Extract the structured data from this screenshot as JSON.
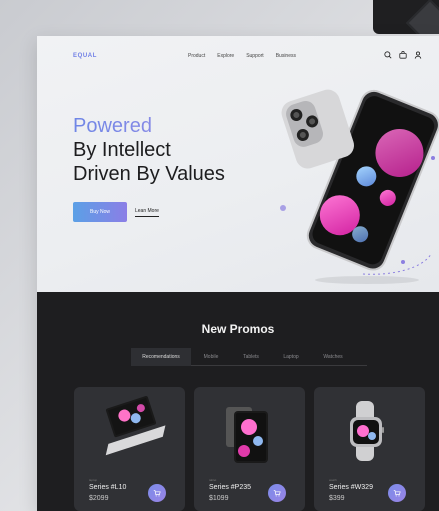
{
  "brand": {
    "logo": "EQUAL"
  },
  "nav": {
    "items": [
      "Product",
      "Explore",
      "Support",
      "Business"
    ]
  },
  "header_icons": [
    "search-icon",
    "bag-icon",
    "user-icon"
  ],
  "hero": {
    "line1": "Powered",
    "line2": "By Intellect",
    "line3": "Driven By Values",
    "buy_label": "Buy Now",
    "learn_label": "Lean More"
  },
  "promos": {
    "title": "New Promos",
    "tabs": [
      "Recomendations",
      "Mobile",
      "Tablets",
      "Laptop",
      "Watches"
    ],
    "active_tab": "Recomendations",
    "products": [
      {
        "tag": "laptop",
        "name": "Series #L10",
        "price": "$2099",
        "icon": "laptop"
      },
      {
        "tag": "tablet",
        "name": "Series #P235",
        "price": "$1099",
        "icon": "tablet"
      },
      {
        "tag": "watch",
        "name": "Series #W329",
        "price": "$399",
        "icon": "watch"
      }
    ]
  },
  "colors": {
    "accent": "#7b86e0",
    "dark_bg": "#1e1e20",
    "card_bg": "#303135",
    "button_gradient_start": "#5ba0e6",
    "button_gradient_end": "#8b7ee6"
  }
}
